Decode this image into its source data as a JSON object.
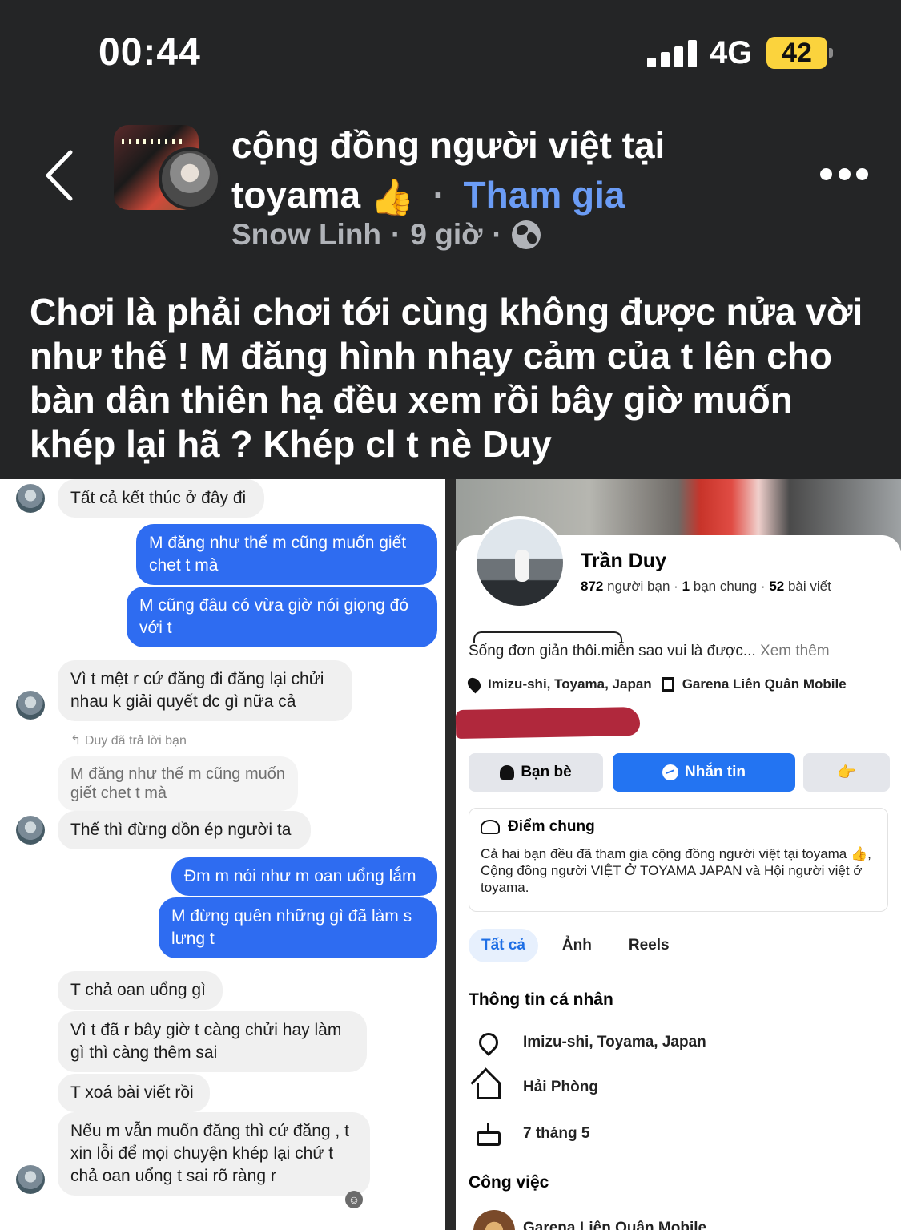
{
  "status_bar": {
    "time": "00:44",
    "network": "4G",
    "battery": "42"
  },
  "header": {
    "group_name": "cộng đồng người việt tại toyama",
    "thumb_emoji": "👍",
    "separator": "·",
    "join_label": "Tham gia",
    "author": "Snow Linh",
    "dot1": "·",
    "time_ago": "9 giờ",
    "dot2": "·"
  },
  "post": {
    "text": "Chơi là phải chơi tới cùng không được nửa vời như thế ! M đăng hình nhạy cảm của t lên cho bàn dân thiên hạ đều xem rồi bây giờ muốn khép lại hã ? Khép cl t nè Duy"
  },
  "chat": {
    "messages": [
      {
        "dir": "in",
        "text": "Tất cả kết thúc ở đây đi"
      },
      {
        "dir": "out",
        "text": "M đăng như thế m cũng muốn giết chet t mà"
      },
      {
        "dir": "out",
        "text": "M cũng đâu có vừa giờ nói giọng đó với t"
      },
      {
        "dir": "in",
        "text": "Vì t mệt r cứ đăng đi đăng lại chửi nhau k giải quyết đc gì nữa cả"
      },
      {
        "dir": "in",
        "text": "Thế thì đừng dồn ép người ta"
      },
      {
        "dir": "out",
        "text": "Đm m nói như m oan uổng lắm"
      },
      {
        "dir": "out",
        "text": "M đừng quên những gì đã làm s lưng t"
      },
      {
        "dir": "in",
        "text": "T chả oan uổng gì"
      },
      {
        "dir": "in",
        "text": "Vì t đã r bây giờ t càng chửi hay làm gì thì càng thêm sai"
      },
      {
        "dir": "in",
        "text": "T xoá bài viết rồi"
      },
      {
        "dir": "in",
        "text": "Nếu m vẫn muốn đăng thì cứ đăng , t xin lỗi để mọi chuyện khép lại chứ t chả oan uổng t sai rõ ràng r"
      }
    ],
    "replied_note": "↰ Duy đã trả lời bạn",
    "quoted_text": "M đăng như thế m cũng muốn giết chet t mà"
  },
  "profile": {
    "name": "Trần Duy",
    "friends_count": "872",
    "friends_label": "người bạn",
    "mutual_count": "1",
    "mutual_label": "bạn chung",
    "posts_count": "52",
    "posts_label": "bài viết",
    "stat_dot": "·",
    "bio": "Sống đơn giản thôi.miễn sao vui là được...",
    "see_more": "Xem thêm",
    "location": "Imizu-shi, Toyama, Japan",
    "workplace": "Garena Liên Quân Mobile",
    "btn_friends": "Bạn bè",
    "btn_message": "Nhắn tin",
    "btn_more_icon": "👉",
    "common_title": "Điểm chung",
    "common_text": "Cả hai bạn đều đã tham gia cộng đồng người việt tại toyama 👍, Cộng đồng người VIỆT Ở TOYAMA JAPAN và Hội người việt ở toyama.",
    "tabs": [
      "Tất cả",
      "Ảnh",
      "Reels"
    ],
    "info_title": "Thông tin cá nhân",
    "info_location": "Imizu-shi, Toyama, Japan",
    "info_hometown": "Hải Phòng",
    "info_birthday": "7 tháng 5",
    "work_title": "Công việc",
    "work_name": "Garena Liên Quân Mobile"
  },
  "colors": {
    "background": "#242526",
    "join": "#6b9cf5",
    "bubble_out": "#2e6cf1",
    "button_blue": "#2374f2",
    "battery": "#fbd33d"
  }
}
